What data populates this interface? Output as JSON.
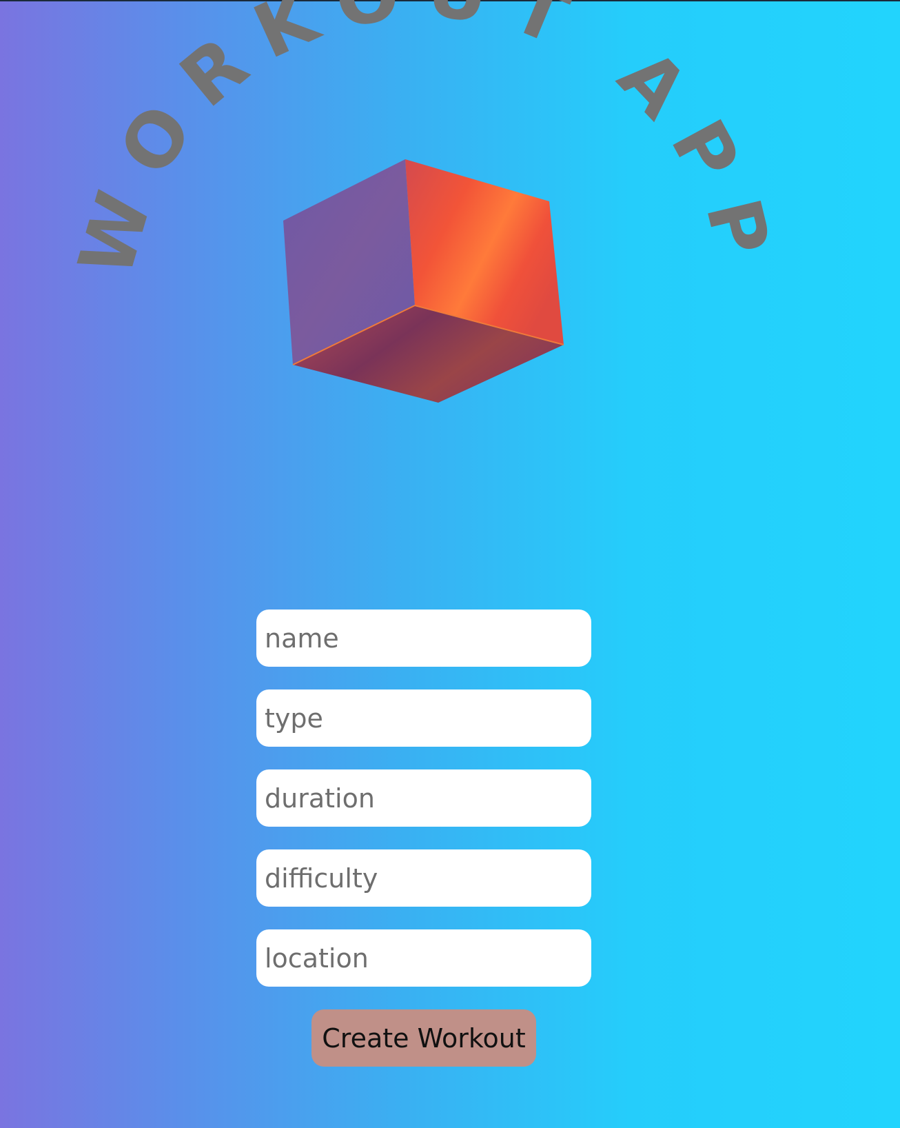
{
  "app": {
    "title": "WORKOUT APP"
  },
  "form": {
    "fields": [
      {
        "placeholder": "name",
        "value": ""
      },
      {
        "placeholder": "type",
        "value": ""
      },
      {
        "placeholder": "duration",
        "value": ""
      },
      {
        "placeholder": "difficulty",
        "value": ""
      },
      {
        "placeholder": "location",
        "value": ""
      }
    ],
    "submit_label": "Create Workout"
  },
  "colors": {
    "title_text": "#737373",
    "button_bg": "#c09088",
    "gradient_start": "#7a74e0",
    "gradient_end": "#22d4fd"
  },
  "icons": {
    "hero": "3d-cube-icon"
  }
}
